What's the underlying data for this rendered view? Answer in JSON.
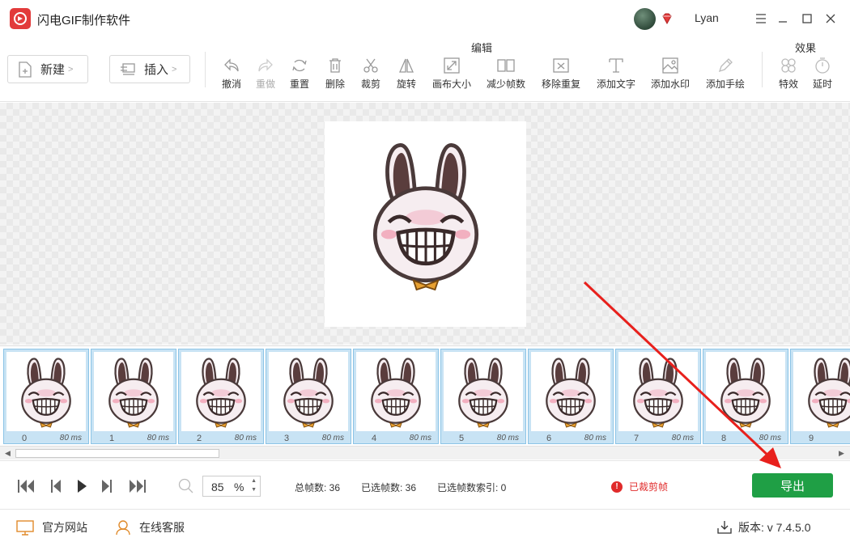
{
  "app": {
    "title": "闪电GIF制作软件",
    "user": "Lyan"
  },
  "toolbar": {
    "new_label": "新建",
    "insert_label": "插入",
    "edit_group_label": "编辑",
    "effect_group_label": "效果",
    "tools": [
      {
        "label": "撤消"
      },
      {
        "label": "重做"
      },
      {
        "label": "重置"
      },
      {
        "label": "删除"
      },
      {
        "label": "裁剪"
      },
      {
        "label": "旋转"
      },
      {
        "label": "画布大小"
      },
      {
        "label": "减少帧数"
      },
      {
        "label": "移除重复"
      },
      {
        "label": "添加文字"
      },
      {
        "label": "添加水印"
      },
      {
        "label": "添加手绘"
      },
      {
        "label": "特效"
      },
      {
        "label": "延时"
      }
    ]
  },
  "frames": [
    {
      "index": "0",
      "delay": "80 ms"
    },
    {
      "index": "1",
      "delay": "80 ms"
    },
    {
      "index": "2",
      "delay": "80 ms"
    },
    {
      "index": "3",
      "delay": "80 ms"
    },
    {
      "index": "4",
      "delay": "80 ms"
    },
    {
      "index": "5",
      "delay": "80 ms"
    },
    {
      "index": "6",
      "delay": "80 ms"
    },
    {
      "index": "7",
      "delay": "80 ms"
    },
    {
      "index": "8",
      "delay": "80 ms"
    },
    {
      "index": "9",
      "delay": ""
    }
  ],
  "playback": {
    "zoom_value": "85",
    "zoom_unit": "%",
    "total_frames": "总帧数: 36",
    "selected_frames": "已选帧数: 36",
    "selected_index": "已选帧数索引: 0",
    "warning": "已裁剪帧",
    "export_label": "导出"
  },
  "footer": {
    "website": "官方网站",
    "support": "在线客服",
    "version": "版本: v 7.4.5.0"
  },
  "colors": {
    "accent_green": "#1f9f45",
    "warning_red": "#e02b2b",
    "frame_bg": "#c8e3f4"
  }
}
